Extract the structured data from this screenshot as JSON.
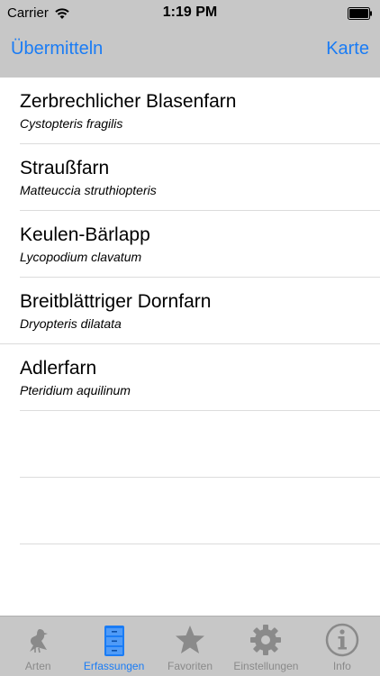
{
  "status": {
    "carrier": "Carrier",
    "time": "1:19 PM"
  },
  "nav": {
    "left": "Übermitteln",
    "right": "Karte"
  },
  "items": [
    {
      "title": "Zerbrechlicher Blasenfarn",
      "subtitle": "Cystopteris fragilis"
    },
    {
      "title": "Straußfarn",
      "subtitle": "Matteuccia struthiopteris"
    },
    {
      "title": "Keulen-Bärlapp",
      "subtitle": "Lycopodium clavatum"
    },
    {
      "title": "Breitblättriger Dornfarn",
      "subtitle": "Dryopteris dilatata"
    },
    {
      "title": "Adlerfarn",
      "subtitle": "Pteridium aquilinum"
    }
  ],
  "tabs": [
    {
      "label": "Arten",
      "icon": "bird-icon"
    },
    {
      "label": "Erfassungen",
      "icon": "drawer-cabinet-icon",
      "active": true
    },
    {
      "label": "Favoriten",
      "icon": "star-icon"
    },
    {
      "label": "Einstellungen",
      "icon": "gear-icon"
    },
    {
      "label": "Info",
      "icon": "info-icon"
    }
  ],
  "colors": {
    "accent": "#1a7cf5",
    "bars": "#c7c7c7",
    "inactive": "#8a8a8a"
  }
}
